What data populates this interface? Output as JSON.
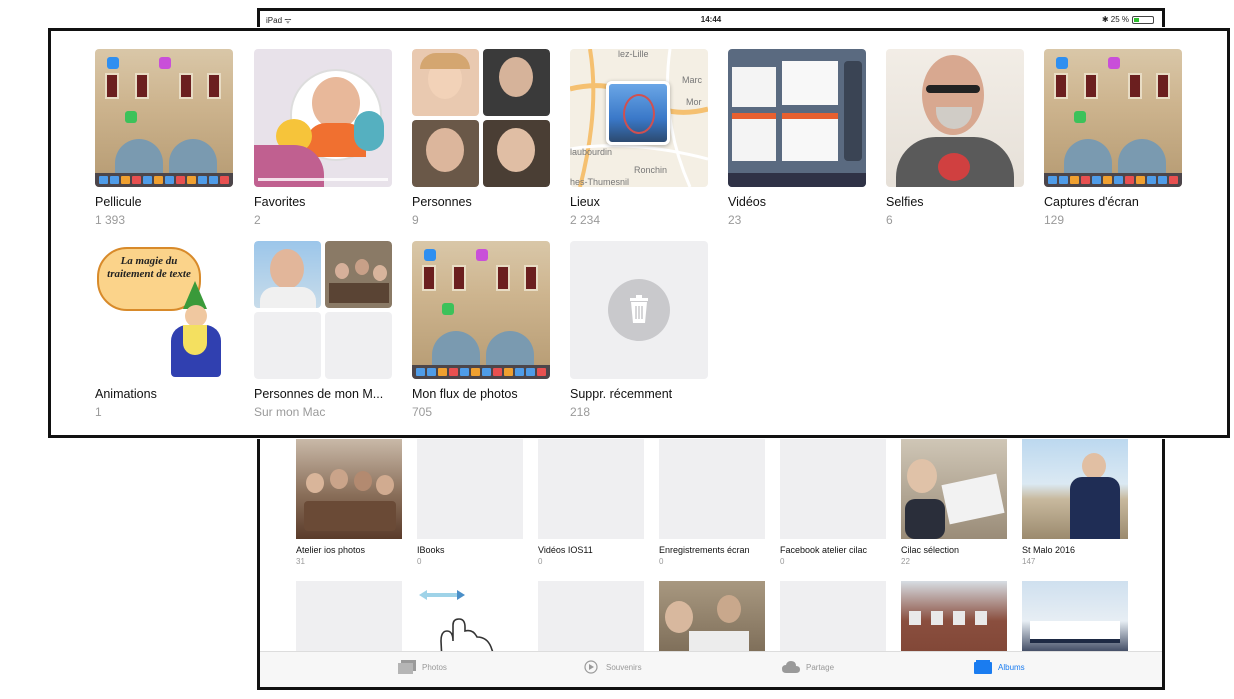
{
  "status": {
    "device": "iPad ᯤ",
    "time": "14:44",
    "battery": "✱ 25 %"
  },
  "overlay_albums": [
    {
      "title": "Pellicule",
      "count": "1 393"
    },
    {
      "title": "Favorites",
      "count": "2"
    },
    {
      "title": "Personnes",
      "count": "9"
    },
    {
      "title": "Lieux",
      "count": "2 234"
    },
    {
      "title": "Vidéos",
      "count": "23"
    },
    {
      "title": "Selfies",
      "count": "6"
    },
    {
      "title": "Captures d'écran",
      "count": "129"
    },
    {
      "title": "Animations",
      "count": "1",
      "art_text": "La magie du traitement de texte"
    },
    {
      "title": "Personnes de mon M...",
      "count": "Sur mon Mac"
    },
    {
      "title": "Mon flux de photos",
      "count": "705"
    },
    {
      "title": "Suppr. récemment",
      "count": "218"
    }
  ],
  "map_labels": [
    "lez-Lille",
    "Marc",
    "Mor",
    "laubourdin",
    "Ronchin",
    "hes-Thumesnil"
  ],
  "background_albums": [
    {
      "title": "Atelier ios photos",
      "count": "31"
    },
    {
      "title": "IBooks",
      "count": "0"
    },
    {
      "title": "Vidéos IOS11",
      "count": "0"
    },
    {
      "title": "Enregistrements écran",
      "count": "0"
    },
    {
      "title": "Facebook atelier cilac",
      "count": "0"
    },
    {
      "title": "Cilac sélection",
      "count": "22"
    },
    {
      "title": "St Malo 2016",
      "count": "147"
    }
  ],
  "tabbar": {
    "photos": "Photos",
    "souvenirs": "Souvenirs",
    "partage": "Partage",
    "albums": "Albums"
  },
  "colors": {
    "accent": "#1a7cf0",
    "count_gray": "#9a9a9a",
    "placeholder": "#efeff1"
  }
}
